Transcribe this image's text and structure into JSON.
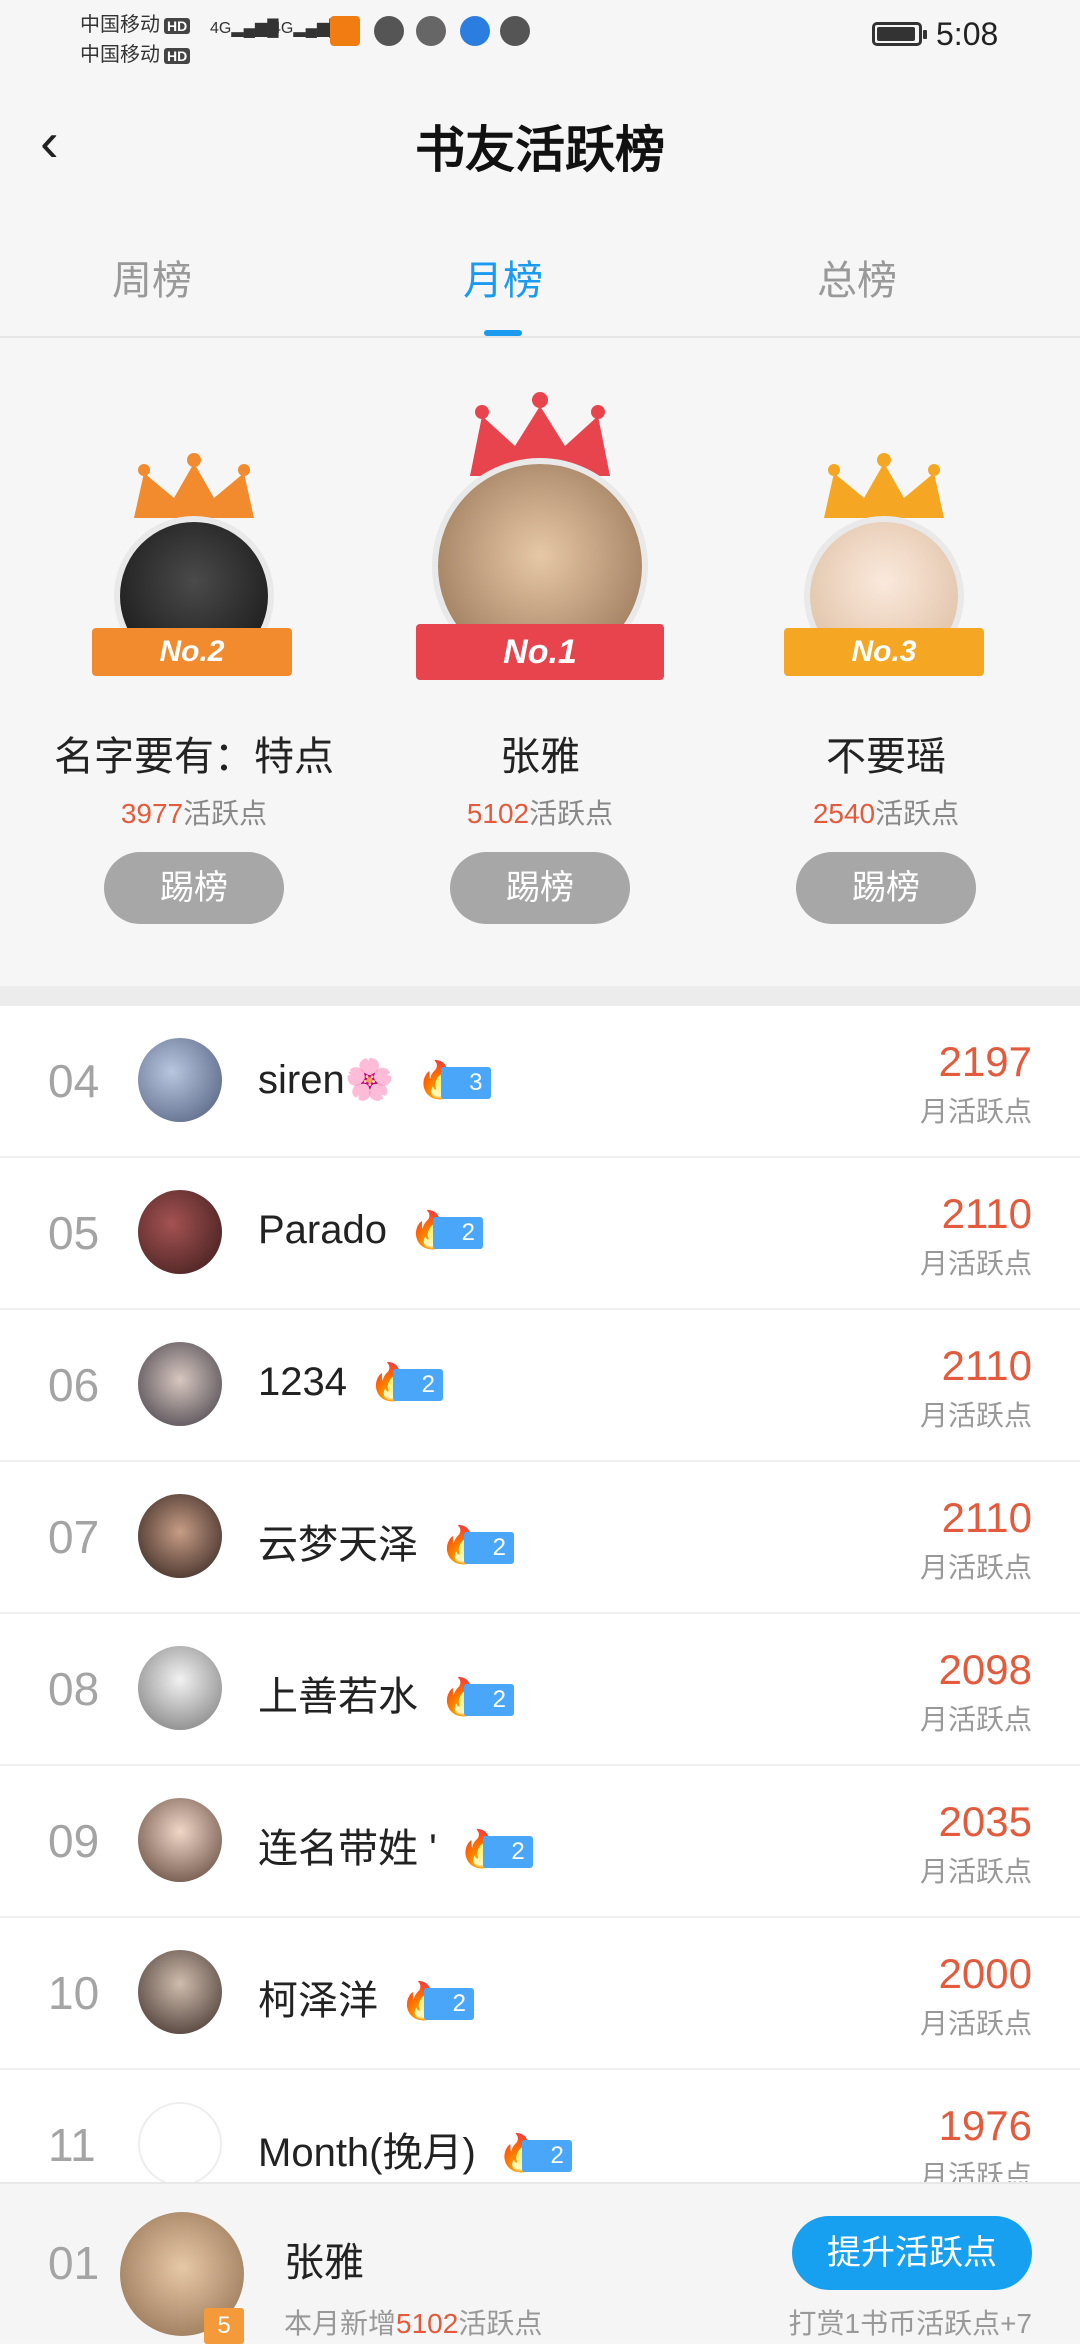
{
  "status_bar": {
    "carrier1": "中国移动",
    "carrier2": "中国移动",
    "hd": "HD",
    "net1": "4G",
    "net2": "4G",
    "time": "5:08"
  },
  "header": {
    "back_icon": "chevron-left-icon",
    "back_glyph": "‹",
    "title": "书友活跃榜"
  },
  "tabs": [
    {
      "label": "周榜",
      "active": false
    },
    {
      "label": "月榜",
      "active": true
    },
    {
      "label": "总榜",
      "active": false
    }
  ],
  "podium": {
    "first": {
      "badge": "No.1",
      "name": "张雅",
      "points": "5102",
      "points_suffix": "活跃点",
      "button": "踢榜"
    },
    "second": {
      "badge": "No.2",
      "name": "名字要有：特点",
      "points": "3977",
      "points_suffix": "活跃点",
      "button": "踢榜"
    },
    "third": {
      "badge": "No.3",
      "name": "不要瑶",
      "points": "2540",
      "points_suffix": "活跃点",
      "button": "踢榜"
    }
  },
  "list": [
    {
      "rank": "04",
      "name": "siren🌸",
      "level": "3",
      "points": "2197",
      "points_label": "月活跃点"
    },
    {
      "rank": "05",
      "name": "Parado",
      "level": "2",
      "points": "2110",
      "points_label": "月活跃点"
    },
    {
      "rank": "06",
      "name": "1234",
      "level": "2",
      "points": "2110",
      "points_label": "月活跃点"
    },
    {
      "rank": "07",
      "name": "云梦天泽",
      "level": "2",
      "points": "2110",
      "points_label": "月活跃点"
    },
    {
      "rank": "08",
      "name": "上善若水",
      "level": "2",
      "points": "2098",
      "points_label": "月活跃点"
    },
    {
      "rank": "09",
      "name": "连名带姓 '",
      "level": "2",
      "points": "2035",
      "points_label": "月活跃点"
    },
    {
      "rank": "10",
      "name": "柯泽洋",
      "level": "2",
      "points": "2000",
      "points_label": "月活跃点"
    },
    {
      "rank": "11",
      "name": "Month(挽月)",
      "level": "2",
      "points": "1976",
      "points_label": "月活跃点"
    }
  ],
  "me": {
    "rank": "01",
    "name": "张雅",
    "level": "5",
    "sub_prefix": "本月新增",
    "sub_points": "5102",
    "sub_suffix": "活跃点",
    "button": "提升活跃点",
    "tip": "打赏1书币活跃点+7"
  },
  "colors": {
    "accent": "#1a9bef",
    "points": "#e35b3c",
    "gold": "#f5a623",
    "red": "#e8444e",
    "orange": "#f28a2e"
  }
}
